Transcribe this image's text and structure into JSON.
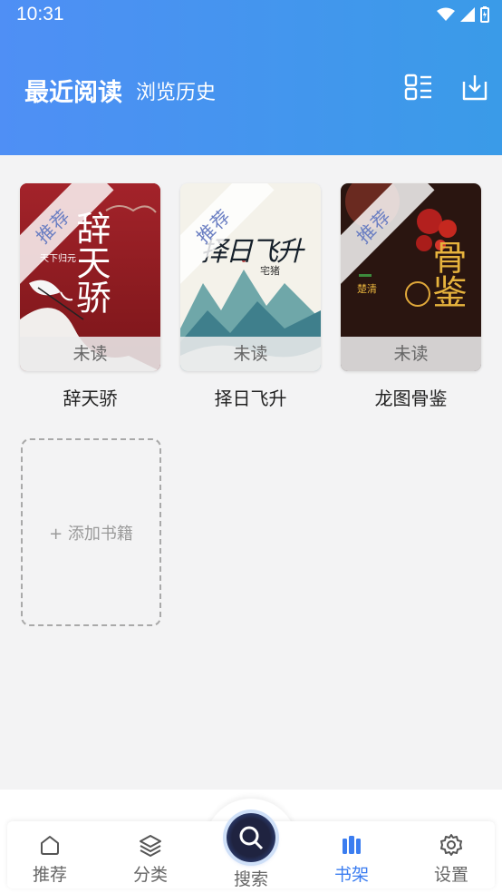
{
  "status": {
    "time": "10:31"
  },
  "header": {
    "title": "最近阅读",
    "subtitle": "浏览历史",
    "grid_icon": "list-grid-icon",
    "import_icon": "download-icon"
  },
  "books": [
    {
      "title": "辞天骄",
      "badge": "推荐",
      "status": "未读",
      "cover_title": "辞天骄",
      "cover_author": "天下归元"
    },
    {
      "title": "择日飞升",
      "badge": "推荐",
      "status": "未读",
      "cover_title": "择日飞升",
      "cover_author": "宅猪"
    },
    {
      "title": "龙图骨鉴",
      "badge": "推荐",
      "status": "未读",
      "cover_title": "骨鉴",
      "cover_author": "楚清"
    }
  ],
  "add_book": {
    "label": "+ 添加书籍"
  },
  "nav": {
    "items": [
      {
        "label": "推荐",
        "icon": "home-icon"
      },
      {
        "label": "分类",
        "icon": "layers-icon"
      },
      {
        "label": "搜索",
        "icon": "search-icon"
      },
      {
        "label": "书架",
        "icon": "bookshelf-icon"
      },
      {
        "label": "设置",
        "icon": "gear-icon"
      }
    ],
    "active": "书架"
  },
  "colors": {
    "accent": "#3b7df0",
    "header_start": "#4f8ff5",
    "header_end": "#3a9be8"
  }
}
